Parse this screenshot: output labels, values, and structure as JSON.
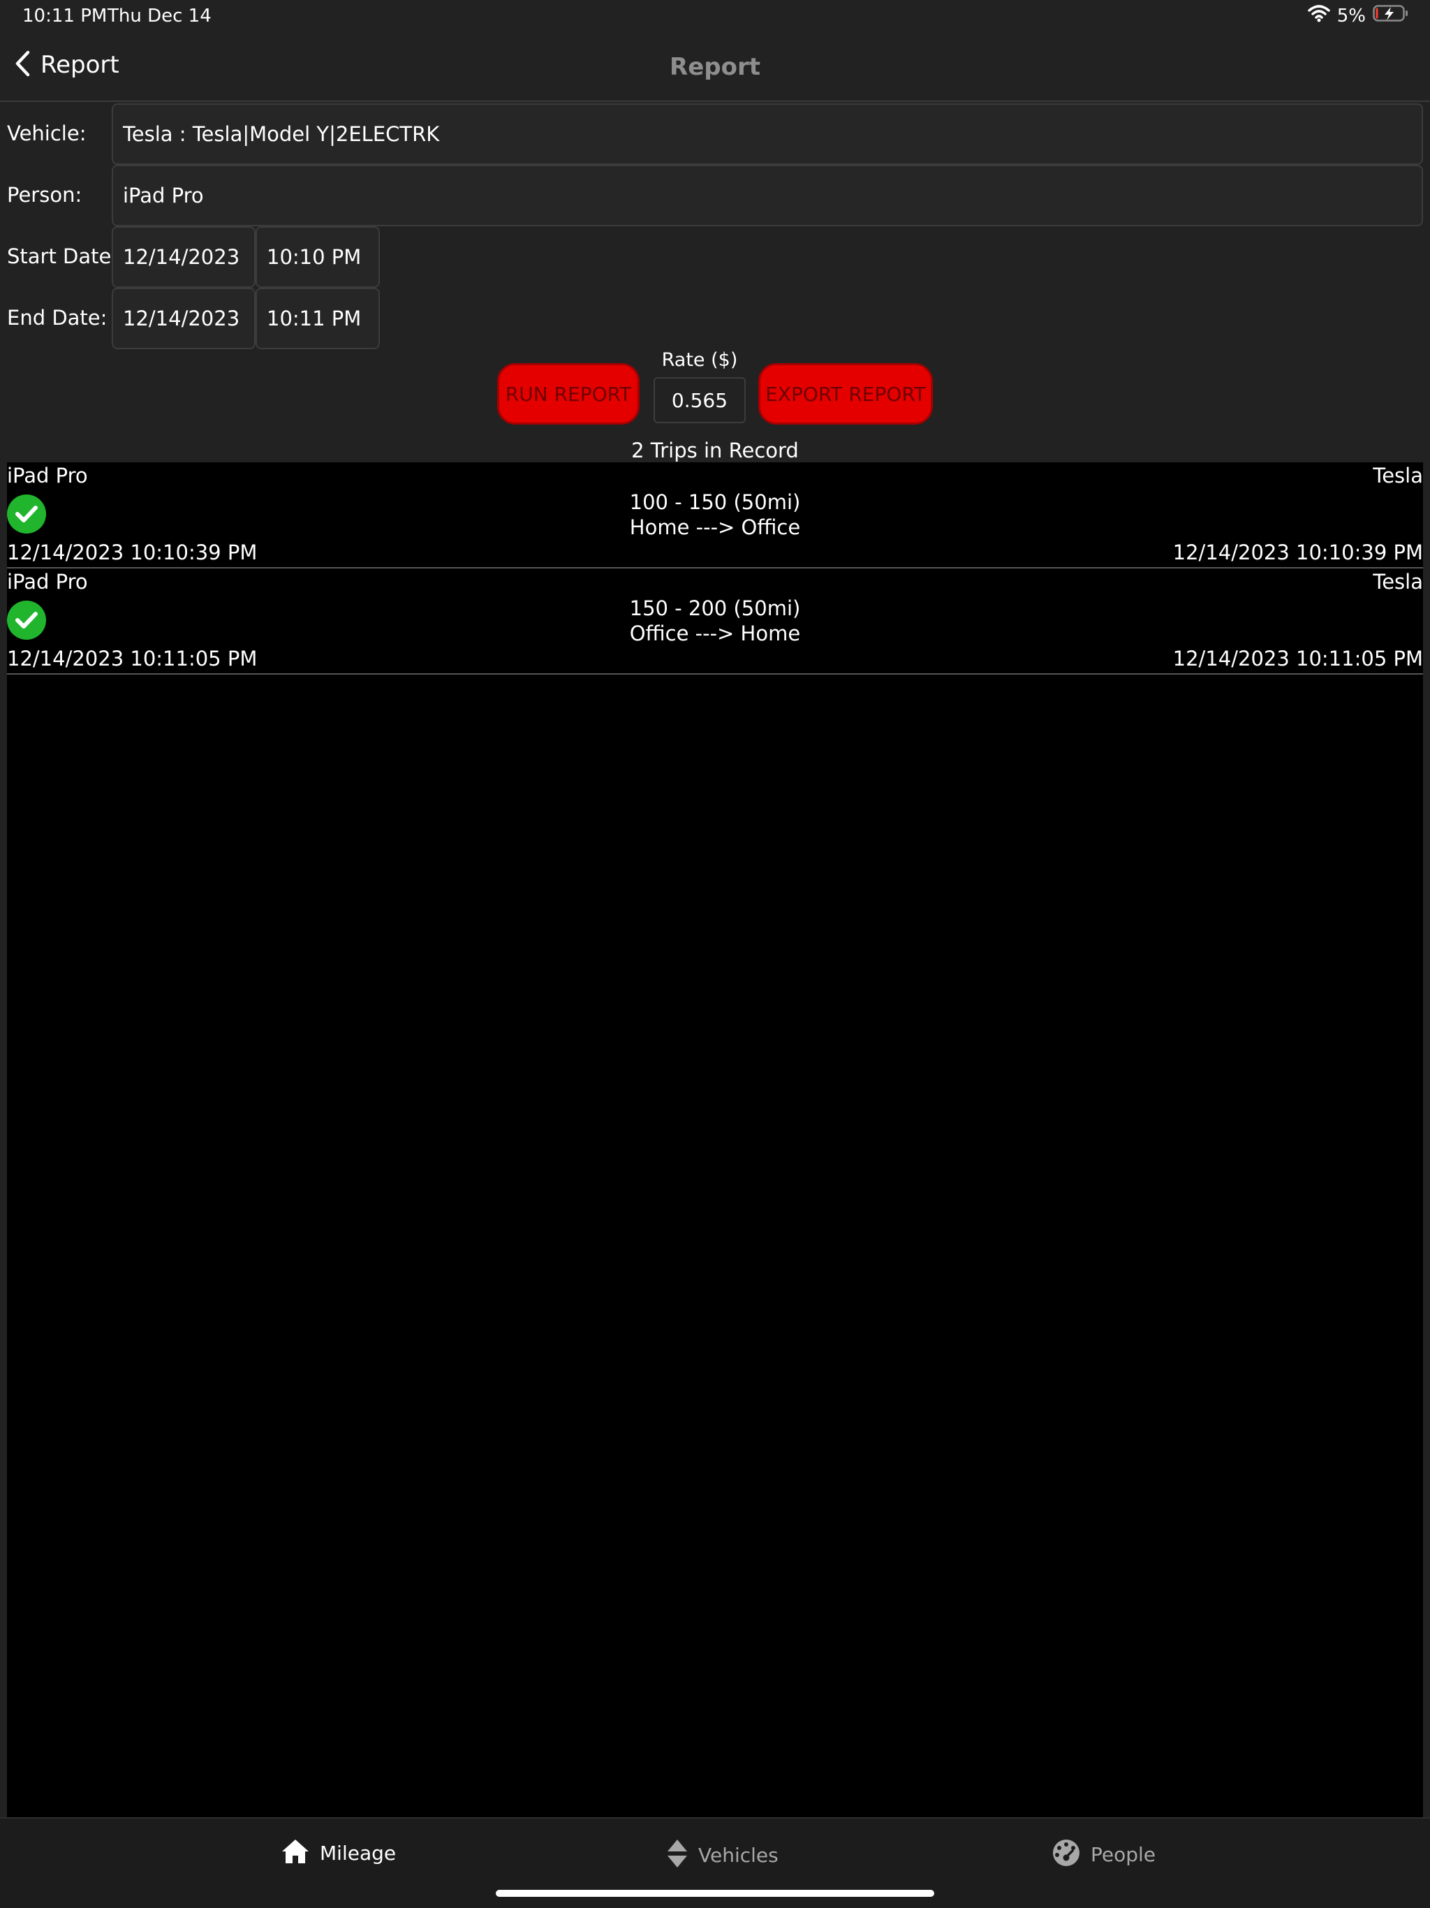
{
  "status_bar": {
    "time": "10:11 PM",
    "date": "Thu Dec 14",
    "battery": "5%",
    "icons": [
      "wifi-icon",
      "battery-charging-icon"
    ]
  },
  "nav": {
    "back_label": "Report",
    "title": "Report"
  },
  "form": {
    "vehicle_label": "Vehicle:",
    "vehicle_value": "Tesla : Tesla|Model Y|2ELECTRK",
    "person_label": "Person:",
    "person_value": "iPad Pro",
    "start_label": "Start Date:",
    "start_date": "12/14/2023",
    "start_time": "10:10 PM",
    "end_label": "End Date:",
    "end_date": "12/14/2023",
    "end_time": "10:11 PM"
  },
  "actions": {
    "run_label": "RUN REPORT",
    "export_label": "EXPORT REPORT",
    "rate_label": "Rate ($)",
    "rate_value": "0.565"
  },
  "summary": {
    "trip_count": "2 Trips in Record"
  },
  "trips": [
    {
      "person": "iPad Pro",
      "vehicle": "Tesla",
      "odometer": "100 - 150 (50mi)",
      "route": "Home ---> Office",
      "start": "12/14/2023 10:10:39 PM",
      "end": "12/14/2023 10:10:39 PM"
    },
    {
      "person": "iPad Pro",
      "vehicle": "Tesla",
      "odometer": "150 - 200 (50mi)",
      "route": "Office ---> Home",
      "start": "12/14/2023 10:11:05 PM",
      "end": "12/14/2023 10:11:05 PM"
    }
  ],
  "tabs": [
    {
      "label": "Mileage",
      "icon": "home-icon"
    },
    {
      "label": "Vehicles",
      "icon": "sort-arrows-icon"
    },
    {
      "label": "People",
      "icon": "dashboard-gauge-icon"
    }
  ],
  "colors": {
    "background": "#222222",
    "list_background": "#000000",
    "button_red": "#e50000",
    "button_text": "#6e0000",
    "check_green": "#20b52c",
    "title_gray": "#8e8e8e"
  }
}
